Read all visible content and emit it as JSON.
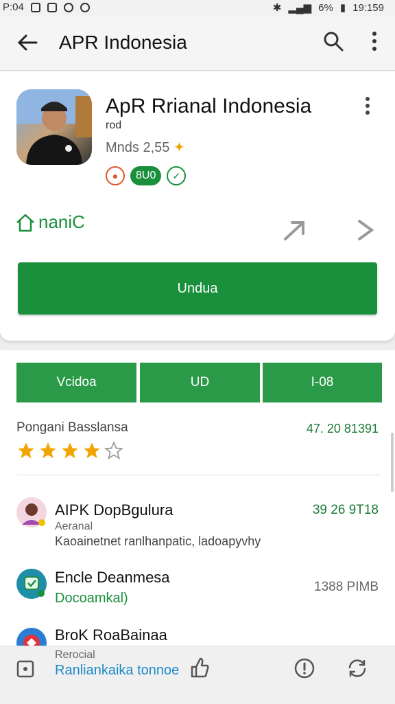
{
  "status_bar": {
    "time_left": "P:04",
    "battery": "6%",
    "time_right": "19:159"
  },
  "app_bar": {
    "title": "APR Indonesia"
  },
  "app": {
    "name": "ApR Rrianal Indonesia",
    "subtitle": "rod",
    "meta": "Mnds 2,55",
    "badge_text": "8U0",
    "home_link": "naniC",
    "install_label": "Undua"
  },
  "tabs": [
    "Vcidoa",
    "UD",
    "I-08"
  ],
  "rating": {
    "label": "Pongani Basslansa",
    "count": "47. 20 81391",
    "stars": 4,
    "max": 5
  },
  "list": [
    {
      "title": "AIPK DopBgulura",
      "subtitle": "Aeranal",
      "desc": "Kaoainetnet ranlhanpatic, ladoapyvhy",
      "right": "39 26 9T18"
    },
    {
      "title": "Encle Deanmesa",
      "subtitle": "Docoamkal)",
      "right": "1388 PIMB"
    },
    {
      "title": "BroK RoaBainaa",
      "subtitle": "Rerocial",
      "desc": "Ranliankaika tonnoe"
    }
  ],
  "colors": {
    "accent": "#1a8f3c",
    "tab": "#2a9a48",
    "star": "#f2a500"
  }
}
